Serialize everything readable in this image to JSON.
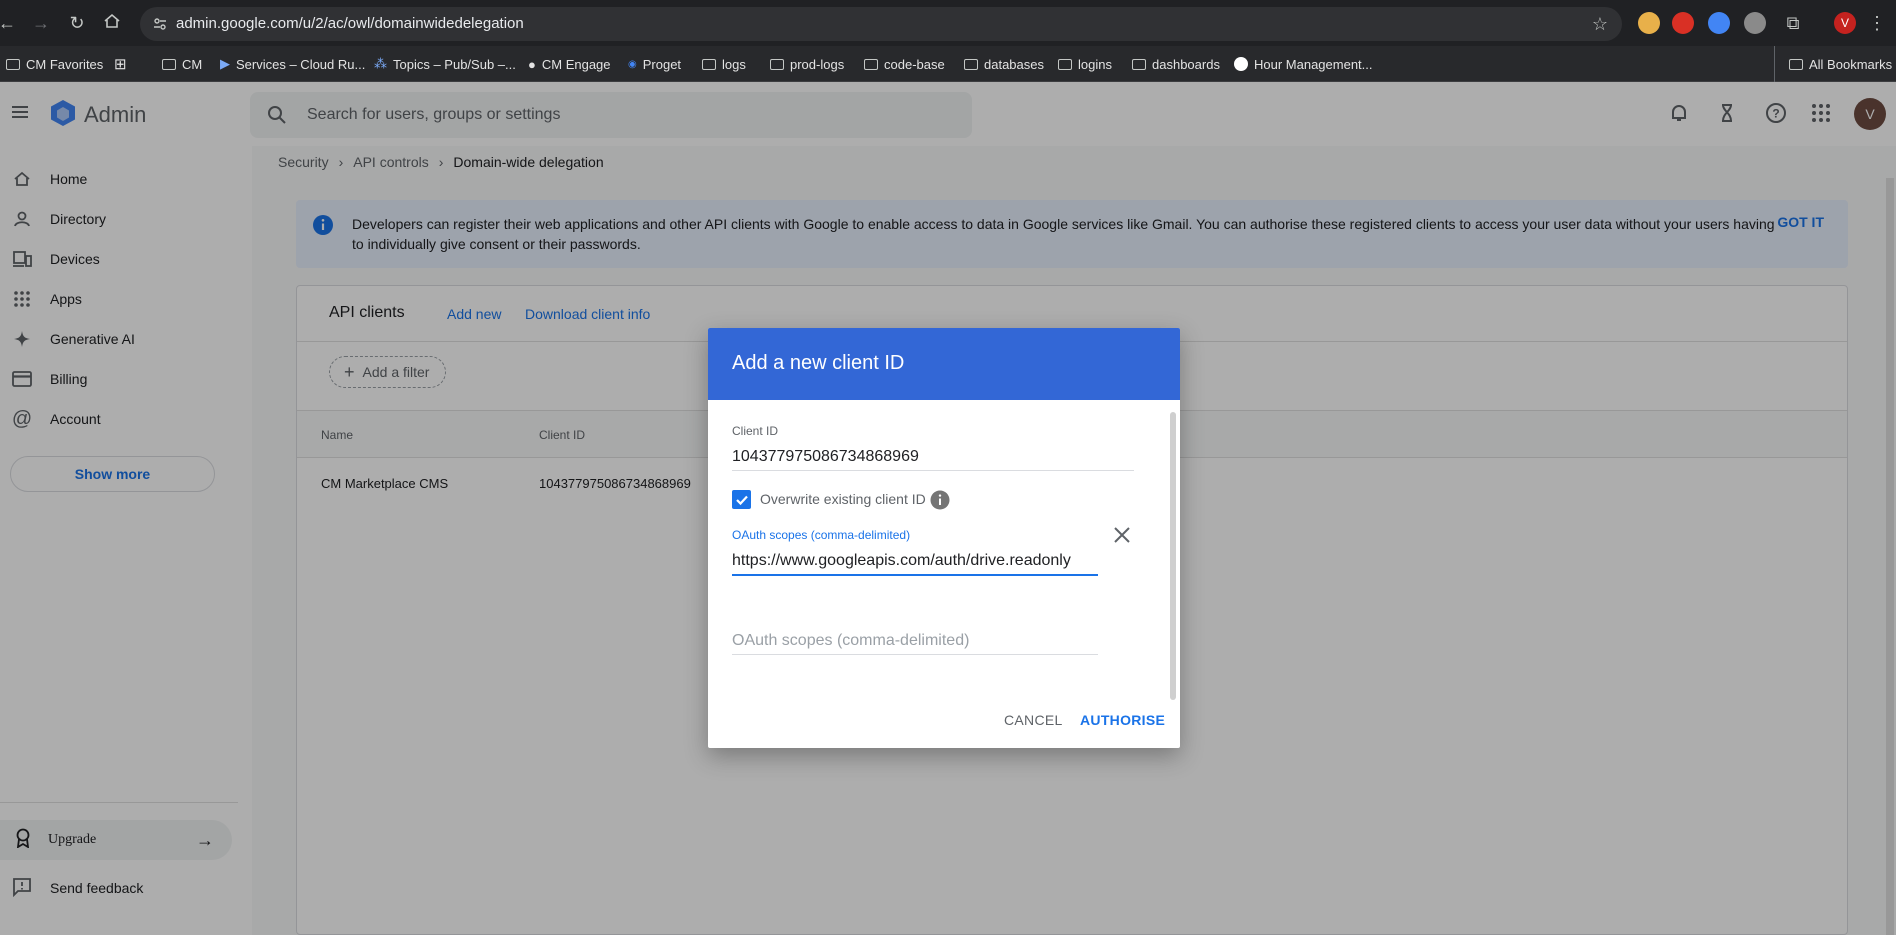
{
  "browser": {
    "url": "admin.google.com/u/2/ac/owl/domainwidedelegation",
    "profile_initial": "V",
    "bookmarks": [
      "CM Favorites",
      "CM",
      "Services – Cloud Ru...",
      "Topics – Pub/Sub –...",
      "CM Engage",
      "Proget",
      "logs",
      "prod-logs",
      "code-base",
      "databases",
      "logins",
      "dashboards",
      "Hour Management..."
    ],
    "all_bookmarks": "All Bookmarks"
  },
  "admin": {
    "product": "Admin",
    "search_placeholder": "Search for users, groups or settings",
    "avatar_initial": "V",
    "sidebar": {
      "items": [
        "Home",
        "Directory",
        "Devices",
        "Apps",
        "Generative AI",
        "Billing",
        "Account"
      ],
      "show_more": "Show more",
      "upgrade": "Upgrade",
      "send_feedback": "Send feedback"
    },
    "breadcrumb": [
      "Security",
      "API controls",
      "Domain-wide delegation"
    ],
    "banner": {
      "text": "Developers can register their web applications and other API clients with Google to enable access to data in Google services like Gmail. You can authorise these registered clients to access your user data without your users having to individually give consent or their passwords.",
      "action": "GOT IT"
    },
    "panel": {
      "title": "API clients",
      "add_new": "Add new",
      "download": "Download client info",
      "filter": "Add a filter",
      "columns": [
        "Name",
        "Client ID"
      ],
      "rows": [
        {
          "name": "CM Marketplace CMS",
          "client_id": "104377975086734868969"
        }
      ]
    }
  },
  "dialog": {
    "title": "Add a new client ID",
    "client_id_label": "Client ID",
    "client_id_value": "104377975086734868969",
    "overwrite_label": "Overwrite existing client ID",
    "overwrite_checked": true,
    "scope_label": "OAuth scopes (comma-delimited)",
    "scope_value": "https://www.googleapis.com/auth/drive.readonly",
    "scope2_placeholder": "OAuth scopes (comma-delimited)",
    "cancel": "CANCEL",
    "authorise": "AUTHORISE"
  },
  "colors": {
    "accent": "#1a73e8",
    "dialog_header": "#3367d6",
    "banner_bg": "#e8f0fe"
  }
}
